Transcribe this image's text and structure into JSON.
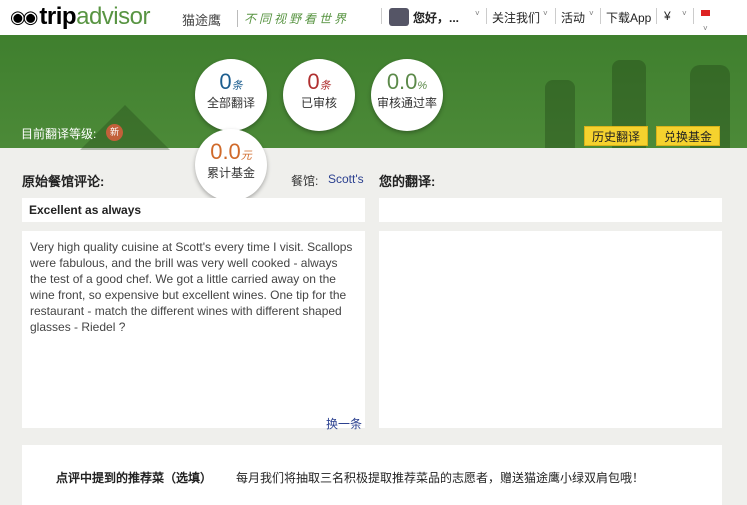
{
  "header": {
    "brand_prefix": "trip",
    "brand_suffix": "advisor",
    "brand_cn": "猫途鹰",
    "slogan": "不同视野看世界",
    "greeting": "您好，...",
    "follow": "关注我们",
    "activity": "活动",
    "download": "下载App",
    "currency": "¥"
  },
  "stats": [
    {
      "value": "0",
      "unit": "条",
      "label": "全部翻译",
      "color": "#1d5e8f"
    },
    {
      "value": "0",
      "unit": "条",
      "label": "已审核",
      "color": "#b03030"
    },
    {
      "value": "0.0",
      "unit": "%",
      "label": "审核通过率",
      "color": "#5c8a4a"
    },
    {
      "value": "0.0",
      "unit": "元",
      "label": "累计基金",
      "color": "#d06a2a"
    }
  ],
  "level": {
    "label": "目前翻译等级:",
    "badge": "新"
  },
  "buttons": {
    "history": "历史翻译",
    "redeem": "兑换基金"
  },
  "left": {
    "heading": "原始餐馆评论:",
    "restaurant_label": "餐馆:",
    "restaurant": "Scott's",
    "title": "Excellent as always",
    "body": "Very high quality cuisine at Scott's every time I visit. Scallops were fabulous, and the brill was very well cooked - always the test of a good chef. We got a little carried away on the wine front, so expensive but excellent wines. One tip for the restaurant - match the different wines with different shaped glasses - Riedel ?",
    "next": "换一条"
  },
  "right": {
    "heading": "您的翻译:"
  },
  "dishes": {
    "label": "点评中提到的推荐菜（选填）",
    "note": "每月我们将抽取三名积极提取推荐菜品的志愿者，赠送猫途鹰小绿双肩包哦！"
  }
}
